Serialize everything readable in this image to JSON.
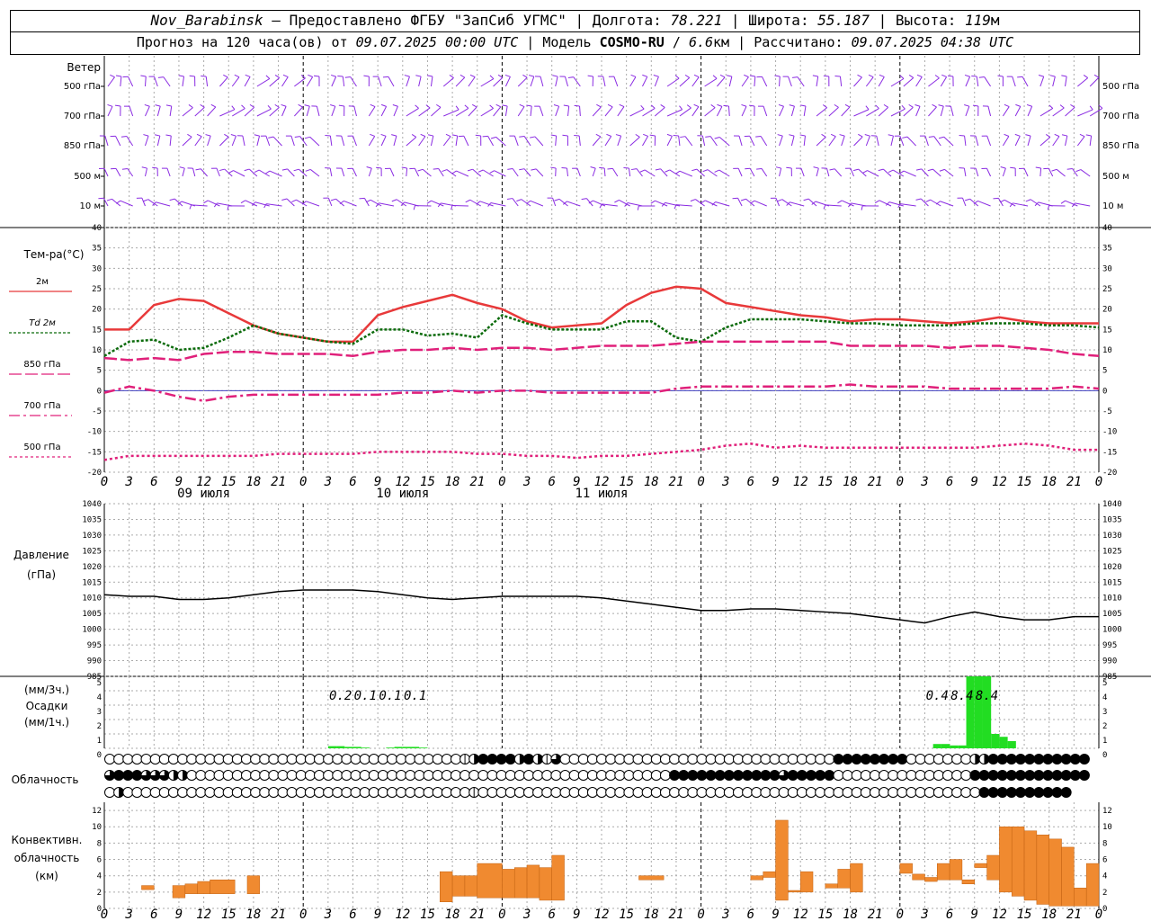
{
  "header": {
    "station": "Nov_Barabinsk",
    "dash": " — ",
    "provided": "Предоставлено ФГБУ \"ЗапСиб УГМС\"",
    "lon_label": "Долгота:",
    "lon_value": "78.221",
    "lat_label": "Широта:",
    "lat_value": "55.187",
    "alt_label": "Высота:",
    "alt_value": "119",
    "alt_unit": "м",
    "sep": " | ",
    "forecast_prefix": "Прогноз на 120 часа(ов) от",
    "forecast_time": "09.07.2025 00:00 UTC",
    "model_label": "Модель",
    "model_name": "COSMO-RU",
    "model_slash": " / ",
    "model_res": "6.6",
    "model_res_unit": "км",
    "computed_label": "Рассчитано:",
    "computed_time": "09.07.2025 04:38 UTC"
  },
  "colors": {
    "wind": "#8a2be2",
    "t2m": "#e8393a",
    "td2m": "#0b6b0b",
    "t850": "#e0207a",
    "t700": "#e0207a",
    "t500": "#e0207a",
    "precip": "#22dd22",
    "conv": "#f08a30",
    "pressure": "#000000",
    "grid": "#aaaaaa"
  },
  "chart_data": [
    {
      "type": "wind_barbs",
      "panel_title": "Ветер",
      "levels": [
        "500 гПа",
        "700 гПа",
        "850 гПа",
        "500 м",
        "10 м"
      ],
      "time_step_hours": 3
    },
    {
      "type": "line",
      "panel_title": "Тем-ра(°C)",
      "ylim": [
        -20,
        40
      ],
      "yticks": [
        "40",
        "35",
        "30",
        "25",
        "20",
        "15",
        "10",
        "5",
        "0",
        "-5",
        "-10",
        "-15",
        "-20"
      ],
      "x_hours": [
        0,
        3,
        6,
        9,
        12,
        15,
        18,
        21,
        24,
        27,
        30,
        33,
        36,
        39,
        42,
        45,
        48,
        51,
        54,
        57,
        60,
        63,
        66,
        69,
        72,
        75,
        78,
        81,
        84,
        87,
        90,
        93,
        96,
        99,
        102,
        105,
        108,
        111,
        114,
        117,
        120
      ],
      "series": [
        {
          "name": "2м",
          "values": [
            15,
            15,
            21,
            22.5,
            22,
            19,
            16,
            14,
            13,
            12,
            12,
            18.5,
            20.5,
            22,
            23.5,
            21.5,
            20,
            17,
            15.5,
            16,
            16.5,
            21,
            24,
            25.5,
            25,
            21.5,
            20.5,
            19.5,
            18.5,
            18,
            17,
            17.5,
            17.5,
            17,
            16.5,
            17,
            18,
            17,
            16.5,
            16.5,
            16.5
          ]
        },
        {
          "name": "Td 2м",
          "values": [
            8.5,
            12,
            12.5,
            10,
            10.5,
            13,
            16,
            14,
            13,
            12,
            11.5,
            15,
            15,
            13.5,
            14,
            13,
            18.5,
            16.5,
            15,
            15,
            15,
            17,
            17,
            13,
            12,
            15.5,
            17.5,
            17.5,
            17.5,
            17,
            16.5,
            16.5,
            16,
            16,
            16,
            16.5,
            16.5,
            16.5,
            16,
            16,
            15.5
          ]
        },
        {
          "name": "850 гПа",
          "values": [
            8,
            7.5,
            8,
            7.5,
            9,
            9.5,
            9.5,
            9,
            9,
            9,
            8.5,
            9.5,
            10,
            10,
            10.5,
            10,
            10.5,
            10.5,
            10,
            10.5,
            11,
            11,
            11,
            11.5,
            12,
            12,
            12,
            12,
            12,
            12,
            11,
            11,
            11,
            11,
            10.5,
            11,
            11,
            10.5,
            10,
            9,
            8.5
          ]
        },
        {
          "name": "700 гПа",
          "values": [
            -0.5,
            1,
            0,
            -1.5,
            -2.5,
            -1.5,
            -1,
            -1,
            -1,
            -1,
            -1,
            -1,
            -0.5,
            -0.5,
            0,
            -0.5,
            0,
            0,
            -0.5,
            -0.5,
            -0.5,
            -0.5,
            -0.5,
            0.5,
            1,
            1,
            1,
            1,
            1,
            1,
            1.5,
            1,
            1,
            1,
            0.5,
            0.5,
            0.5,
            0.5,
            0.5,
            1,
            0.5
          ]
        },
        {
          "name": "500 гПа",
          "values": [
            -17,
            -16,
            -16,
            -16,
            -16,
            -16,
            -16,
            -15.5,
            -15.5,
            -15.5,
            -15.5,
            -15,
            -15,
            -15,
            -15,
            -15.5,
            -15.5,
            -16,
            -16,
            -16.5,
            -16,
            -16,
            -15.5,
            -15,
            -14.5,
            -13.5,
            -13,
            -14,
            -13.5,
            -14,
            -14,
            -14,
            -14,
            -14,
            -14,
            -14,
            -13.5,
            -13,
            -13.5,
            -14.5,
            -14.5
          ]
        }
      ]
    },
    {
      "type": "line",
      "panel_title": "Давление",
      "panel_unit": "(гПа)",
      "ylim": [
        985,
        1040
      ],
      "yticks": [
        "1040",
        "1035",
        "1030",
        "1025",
        "1020",
        "1015",
        "1010",
        "1005",
        "1000",
        "995",
        "990",
        "985"
      ],
      "x_hours": [
        0,
        3,
        6,
        9,
        12,
        15,
        18,
        21,
        24,
        27,
        30,
        33,
        36,
        39,
        42,
        45,
        48,
        51,
        54,
        57,
        60,
        63,
        66,
        69,
        72,
        75,
        78,
        81,
        84,
        87,
        90,
        93,
        96,
        99,
        102,
        105,
        108,
        111,
        114,
        117,
        120
      ],
      "series": [
        {
          "name": "Давление",
          "values": [
            1011,
            1010.5,
            1010.5,
            1009.5,
            1009.5,
            1010,
            1011,
            1012,
            1012.5,
            1012.5,
            1012.5,
            1012,
            1011,
            1010,
            1009.5,
            1010,
            1010.5,
            1010.5,
            1010.5,
            1010.5,
            1010,
            1009,
            1008,
            1007,
            1006,
            1006,
            1006.5,
            1006.5,
            1006,
            1005.5,
            1005,
            1004,
            1003,
            1002,
            1004,
            1005.5,
            1004,
            1003,
            1003,
            1004,
            1004
          ]
        }
      ]
    },
    {
      "type": "bar",
      "panel_title": "Осадки",
      "panel_units": [
        "(мм/3ч.)",
        "(мм/1ч.)"
      ],
      "ylim": [
        0,
        5
      ],
      "yticks": [
        "5",
        "4",
        "3",
        "2",
        "1",
        "0"
      ],
      "x_hours_start": [
        27,
        28,
        29,
        30,
        31,
        34,
        35,
        36,
        37,
        38,
        100,
        101,
        102,
        103,
        104,
        105,
        106,
        107,
        108,
        109
      ],
      "values": [
        0.15,
        0.15,
        0.1,
        0.1,
        0.05,
        0.05,
        0.1,
        0.1,
        0.1,
        0.05,
        0.3,
        0.3,
        0.2,
        0.2,
        5.5,
        5.5,
        5.5,
        1.0,
        0.8,
        0.5
      ],
      "labels_3h": [
        {
          "hour": 28.5,
          "text": "0.2"
        },
        {
          "hour": 31.5,
          "text": "0.1"
        },
        {
          "hour": 34.5,
          "text": "0.1"
        },
        {
          "hour": 37.5,
          "text": "0.1"
        },
        {
          "hour": 100.5,
          "text": "0.4"
        },
        {
          "hour": 103.5,
          "text": "8.4"
        },
        {
          "hour": 106.5,
          "text": "8.4"
        }
      ]
    },
    {
      "type": "symbols",
      "panel_title": "Облачность",
      "rows": [
        "OOOOOOOOOOOOOOOOOOOOOOOOOOOOOOOOOOOOOOOCHFFFFHFHCQOOOOOOOOOOOOOOOOOOOOOOOOOOOOOOFFFFFFFFOOOOOOOHHFFFFFFFFFFF",
        "QFFFQQQHHOOOOOOOOOOOOOOOOOOOOOOOOOOOOOOOOOOOOOOOOOOOOOOOOOOOOOFFFFFFFFFFFFQFFFFFOOOOOOOOOOOOOOOFFFFFFFFFFFFF",
        "OHOOOOOOOOOOOOOOOOOOOOOOOOOOOOOOOOOOOOOOCOOOOOOOOOOOOOOOOOOOOOOOOOOOOOOOOOOOOOOOOOOOOOOOOOOOOOOOFFFFFFFFFF"
      ]
    },
    {
      "type": "bar",
      "panel_title": "Конвективн. облачность (км)",
      "ylim": [
        0,
        13
      ],
      "yticks": [
        "12",
        "10",
        "8",
        "6",
        "4",
        "2",
        "0"
      ],
      "segments": [
        {
          "h0": 3,
          "h1": 4,
          "lo": 2.3,
          "hi": 2.8
        },
        {
          "h0": 5.5,
          "h1": 6.5,
          "lo": 1.3,
          "hi": 2.8
        },
        {
          "h0": 6.5,
          "h1": 7.5,
          "lo": 1.8,
          "hi": 3.0
        },
        {
          "h0": 7.5,
          "h1": 8.5,
          "lo": 1.8,
          "hi": 3.3
        },
        {
          "h0": 8.5,
          "h1": 10.5,
          "lo": 1.8,
          "hi": 3.5
        },
        {
          "h0": 11.5,
          "h1": 12.5,
          "lo": 1.8,
          "hi": 4.0
        },
        {
          "h0": 27,
          "h1": 28,
          "lo": 0.8,
          "hi": 4.5
        },
        {
          "h0": 28,
          "h1": 29,
          "lo": 1.5,
          "hi": 4.0
        },
        {
          "h0": 29,
          "h1": 30,
          "lo": 1.5,
          "hi": 4.0
        },
        {
          "h0": 30,
          "h1": 32,
          "lo": 1.3,
          "hi": 5.5
        },
        {
          "h0": 32,
          "h1": 33,
          "lo": 1.3,
          "hi": 4.8
        },
        {
          "h0": 33,
          "h1": 34,
          "lo": 1.3,
          "hi": 5.0
        },
        {
          "h0": 34,
          "h1": 35,
          "lo": 1.3,
          "hi": 5.3
        },
        {
          "h0": 35,
          "h1": 36,
          "lo": 1.0,
          "hi": 5.0
        },
        {
          "h0": 36,
          "h1": 37,
          "lo": 1.0,
          "hi": 6.5
        },
        {
          "h0": 43,
          "h1": 45,
          "lo": 3.5,
          "hi": 4.0
        },
        {
          "h0": 52,
          "h1": 53,
          "lo": 3.5,
          "hi": 4.0
        },
        {
          "h0": 53,
          "h1": 54,
          "lo": 3.8,
          "hi": 4.5
        },
        {
          "h0": 54,
          "h1": 55,
          "lo": 1.0,
          "hi": 10.8
        },
        {
          "h0": 55,
          "h1": 56,
          "lo": 2.0,
          "hi": 2.2
        },
        {
          "h0": 56,
          "h1": 57,
          "lo": 2.0,
          "hi": 4.5
        },
        {
          "h0": 58,
          "h1": 59,
          "lo": 2.5,
          "hi": 3.0
        },
        {
          "h0": 59,
          "h1": 60,
          "lo": 2.5,
          "hi": 4.8
        },
        {
          "h0": 60,
          "h1": 61,
          "lo": 2.0,
          "hi": 5.5
        },
        {
          "h0": 64,
          "h1": 65,
          "lo": 4.3,
          "hi": 5.5
        },
        {
          "h0": 65,
          "h1": 66,
          "lo": 3.5,
          "hi": 4.2
        },
        {
          "h0": 66,
          "h1": 67,
          "lo": 3.3,
          "hi": 3.8
        },
        {
          "h0": 67,
          "h1": 68,
          "lo": 3.5,
          "hi": 5.5
        },
        {
          "h0": 68,
          "h1": 69,
          "lo": 3.5,
          "hi": 6.0
        },
        {
          "h0": 69,
          "h1": 70,
          "lo": 3.0,
          "hi": 3.5
        },
        {
          "h0": 70,
          "h1": 71,
          "lo": 5.0,
          "hi": 5.5
        },
        {
          "h0": 71,
          "h1": 72,
          "lo": 3.5,
          "hi": 6.5
        },
        {
          "h0": 72,
          "h1": 73,
          "lo": 2.0,
          "hi": 10.0
        },
        {
          "h0": 73,
          "h1": 74,
          "lo": 1.5,
          "hi": 10.0
        },
        {
          "h0": 74,
          "h1": 75,
          "lo": 1.0,
          "hi": 9.5
        },
        {
          "h0": 75,
          "h1": 76,
          "lo": 0.5,
          "hi": 9.0
        },
        {
          "h0": 76,
          "h1": 77,
          "lo": 0.3,
          "hi": 8.5
        },
        {
          "h0": 77,
          "h1": 78,
          "lo": 0.3,
          "hi": 7.5
        },
        {
          "h0": 78,
          "h1": 79,
          "lo": 0.3,
          "hi": 2.5
        },
        {
          "h0": 79,
          "h1": 80,
          "lo": 0.3,
          "hi": 5.5
        }
      ]
    }
  ],
  "axis": {
    "hour_labels": [
      "0",
      "3",
      "6",
      "9",
      "12",
      "15",
      "18",
      "21"
    ],
    "day_labels": [
      "09 июля",
      "10 июля",
      "11 июля"
    ]
  }
}
